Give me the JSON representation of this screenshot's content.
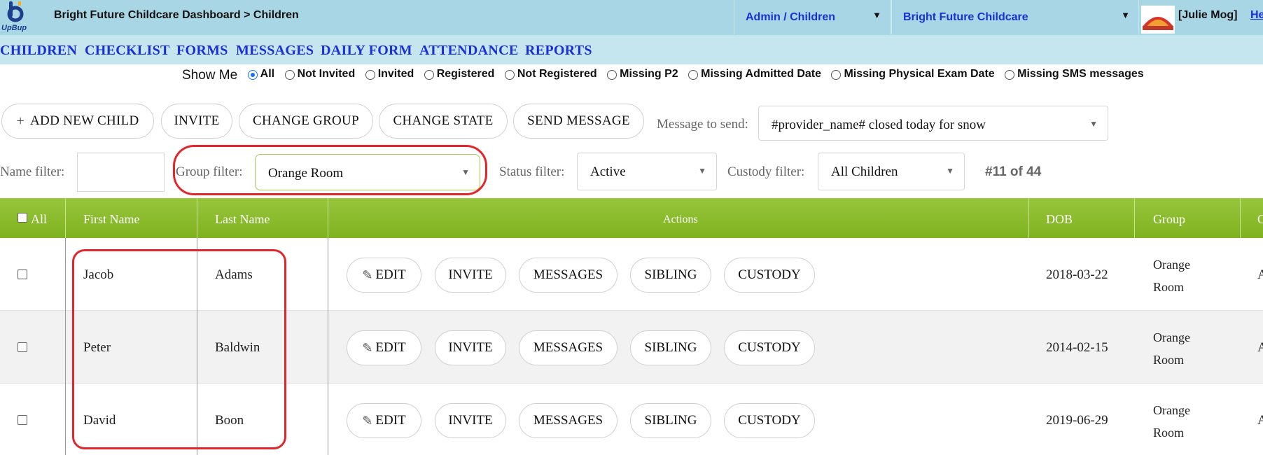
{
  "header": {
    "logo_text": "UpBup",
    "title": "Bright Future Childcare Dashboard > Children",
    "role_select": "Admin / Children",
    "provider_select": "Bright Future Childcare",
    "user": "[Julie Mog]",
    "help_link": "He"
  },
  "nav": [
    "CHILDREN",
    "CHECKLIST",
    "FORMS",
    "MESSAGES",
    "DAILY FORM",
    "ATTENDANCE",
    "REPORTS"
  ],
  "show_me": {
    "label": "Show Me",
    "options": [
      "All",
      "Not Invited",
      "Invited",
      "Registered",
      "Not Registered",
      "Missing P2",
      "Missing Admitted Date",
      "Missing Physical Exam Date",
      "Missing SMS messages"
    ],
    "selected": "All"
  },
  "toolbar": {
    "add_child": "ADD NEW CHILD",
    "add_icon": "plus-icon",
    "invite": "INVITE",
    "change_group": "CHANGE GROUP",
    "change_state": "CHANGE STATE",
    "send_message": "SEND MESSAGE",
    "message_label": "Message to send:",
    "message_value": "#provider_name# closed today for snow"
  },
  "filters": {
    "name_label": "Name filter:",
    "name_value": "",
    "group_label": "Group filter:",
    "group_value": "Orange Room",
    "status_label": "Status filter:",
    "status_value": "Active",
    "custody_label": "Custody filter:",
    "custody_value": "All Children",
    "count": "#11 of 44"
  },
  "table": {
    "headers": {
      "all": "All",
      "first_name": "First Name",
      "last_name": "Last Name",
      "actions": "Actions",
      "dob": "DOB",
      "group": "Group"
    },
    "actions": [
      "EDIT",
      "INVITE",
      "MESSAGES",
      "SIBLING",
      "CUSTODY"
    ],
    "rows": [
      {
        "first": "Jacob",
        "last": "Adams",
        "dob": "2018-03-22",
        "group_line1": "Orange",
        "group_line2": "Room"
      },
      {
        "first": "Peter",
        "last": "Baldwin",
        "dob": "2014-02-15",
        "group_line1": "Orange",
        "group_line2": "Room"
      },
      {
        "first": "David",
        "last": "Boon",
        "dob": "2019-06-29",
        "group_line1": "Orange",
        "group_line2": "Room"
      }
    ]
  },
  "colors": {
    "header_bg": "#a9d6e5",
    "nav_bg": "#c5e6ef",
    "link": "#1a2fd6",
    "table_header": "#8dbc2c",
    "highlight": "#e3262b"
  }
}
